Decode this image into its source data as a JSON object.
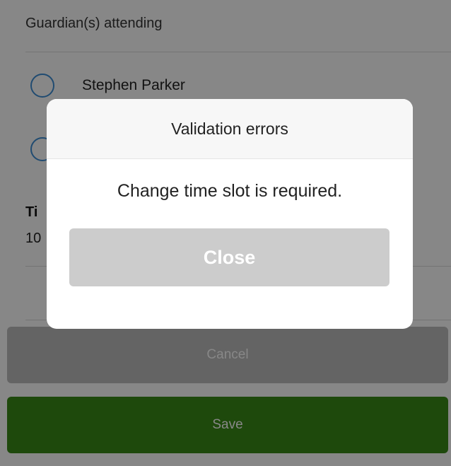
{
  "form": {
    "guardians_header": "Guardian(s) attending",
    "guardians": [
      {
        "name": "Stephen Parker",
        "selected": false
      },
      {
        "name": "",
        "selected": false
      }
    ],
    "time_label": "Ti",
    "time_value": "10"
  },
  "actions": {
    "cancel_label": "Cancel",
    "save_label": "Save"
  },
  "dialog": {
    "title": "Validation errors",
    "message": "Change time slot is required.",
    "close_label": "Close"
  },
  "colors": {
    "radio_border": "#3d8fd6",
    "save_button": "#3a8a17",
    "cancel_button": "#bdbdbd",
    "close_button": "#cccccc"
  }
}
